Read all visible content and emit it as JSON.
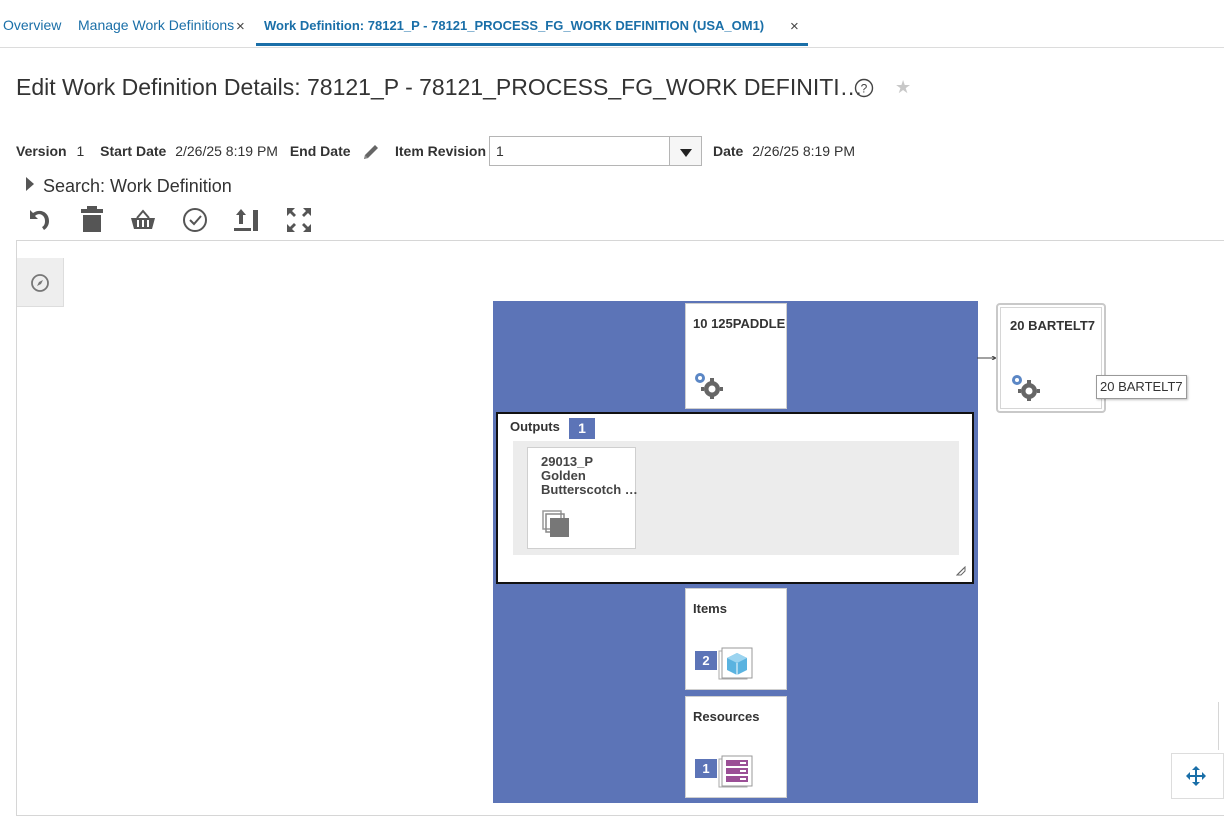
{
  "tabs": [
    {
      "label": "Overview"
    },
    {
      "label": "Manage Work Definitions",
      "close": "×"
    },
    {
      "label": "Work Definition: 78121_P - 78121_PROCESS_FG_WORK DEFINITION (USA_OM1)",
      "close": "×"
    }
  ],
  "page": {
    "title": "Edit Work Definition Details: 78121_P - 78121_PROCESS_FG_WORK DEFINITI…"
  },
  "meta": {
    "version_label": "Version",
    "version_value": "1",
    "start_date_label": "Start Date",
    "start_date_value": "2/26/25 8:19 PM",
    "end_date_label": "End Date",
    "item_revision_label": "Item Revision",
    "item_revision_value": "1",
    "date_label": "Date",
    "date_value": "2/26/25 8:19 PM"
  },
  "search": {
    "label": "Search: Work Definition"
  },
  "toolbar": {
    "icons": [
      "undo-icon",
      "delete-icon",
      "basket-icon",
      "check-circle-icon",
      "refresh-icon",
      "expand-icon"
    ]
  },
  "diagram": {
    "operation1": {
      "title": "10 125PADDLE"
    },
    "outputs": {
      "label": "Outputs",
      "count": "1",
      "item_line1": "29013_P",
      "item_line2": "Golden",
      "item_line3": "Butterscotch …"
    },
    "items": {
      "label": "Items",
      "count": "2"
    },
    "resources": {
      "label": "Resources",
      "count": "1"
    },
    "operation2": {
      "title": "20 BARTELT7"
    },
    "tooltip": "20 BARTELT7"
  },
  "colors": {
    "accent": "#1a6fa8",
    "operation_bg": "#5c74b7",
    "badge": "#5c74b7"
  }
}
